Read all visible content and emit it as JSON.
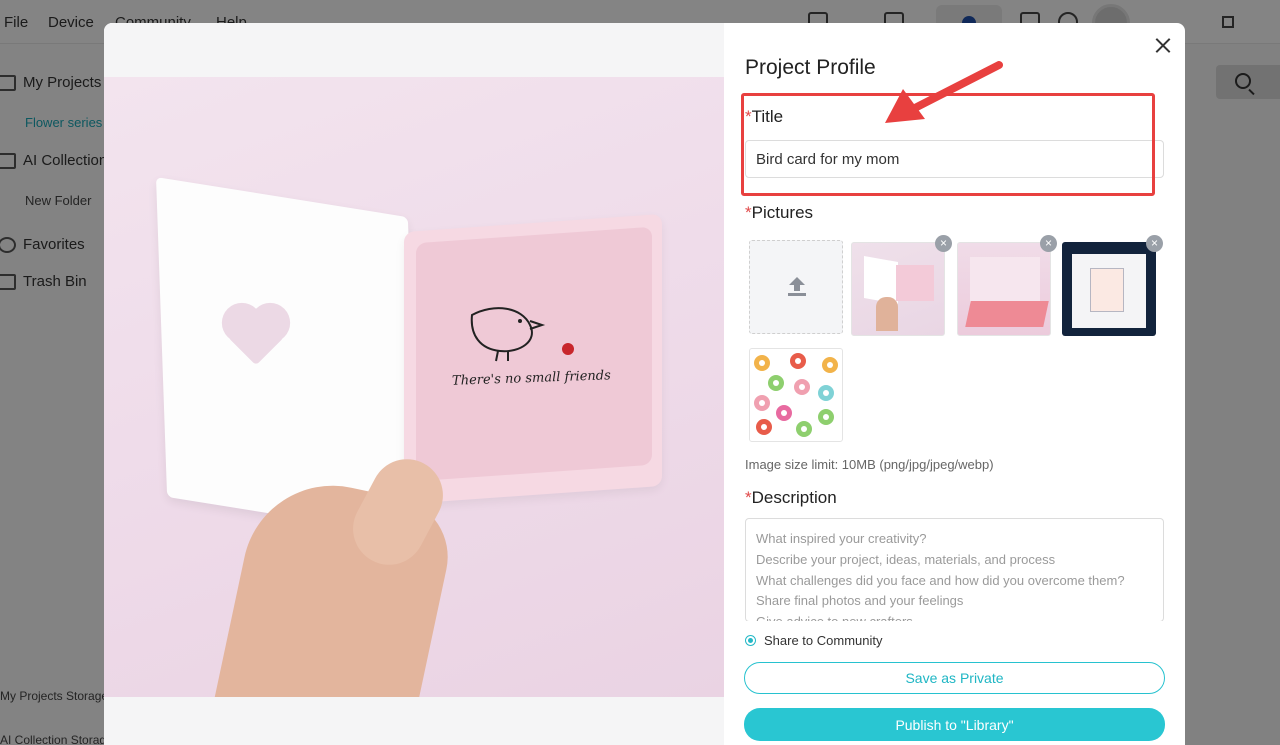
{
  "menubar": {
    "items": [
      "File",
      "Device",
      "Community",
      "Help"
    ]
  },
  "sidebar": {
    "my_projects": "My Projects",
    "flower_series": "Flower series",
    "ai_collection": "AI Collection",
    "new_folder": "New Folder",
    "favorites": "Favorites",
    "trash_bin": "Trash Bin",
    "projects_storage": "My Projects Storage",
    "collection_storage": "AI Collection Storage"
  },
  "dialog": {
    "heading": "Project Profile",
    "title_label": "Title",
    "title_value": "Bird card for my mom",
    "pictures_label": "Pictures",
    "remove_glyph": "×",
    "image_limit": "Image size limit: 10MB (png/jpg/jpeg/webp)",
    "description_label": "Description",
    "description_placeholder": "What inspired your creativity?\nDescribe your project, ideas, materials, and process\nWhat challenges did you face and how did you overcome them?\nShare final photos and your feelings\nGive advice to new crafters",
    "share_label": "Share to Community",
    "save_private": "Save as Private",
    "publish": "Publish to \"Library\"",
    "required_mark": "*"
  },
  "preview": {
    "card_text": "There's no small friends"
  },
  "colors": {
    "accent": "#29c6d2",
    "required": "#e04a4a",
    "highlight_box": "#e8403f"
  }
}
